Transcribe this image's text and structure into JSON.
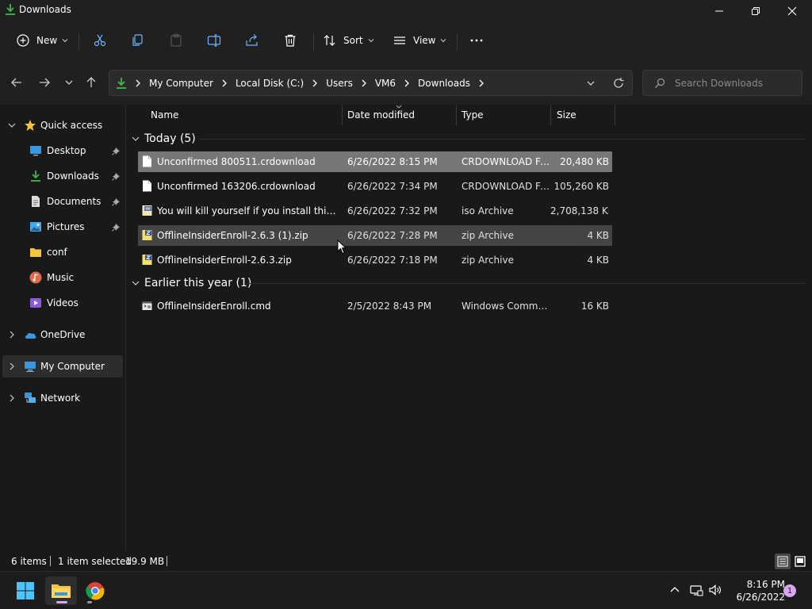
{
  "window": {
    "title": "Downloads"
  },
  "toolbar": {
    "new_label": "New",
    "sort_label": "Sort",
    "view_label": "View"
  },
  "address": {
    "crumbs": [
      "My Computer",
      "Local Disk (C:)",
      "Users",
      "VM6",
      "Downloads"
    ],
    "search_placeholder": "Search Downloads"
  },
  "sidebar": {
    "quick_access": "Quick access",
    "items": [
      {
        "label": "Desktop",
        "icon": "desktop-icon",
        "pinned": true
      },
      {
        "label": "Downloads",
        "icon": "download-icon",
        "pinned": true
      },
      {
        "label": "Documents",
        "icon": "document-icon",
        "pinned": true
      },
      {
        "label": "Pictures",
        "icon": "picture-icon",
        "pinned": true
      },
      {
        "label": "conf",
        "icon": "folder-icon",
        "pinned": false
      },
      {
        "label": "Music",
        "icon": "music-icon",
        "pinned": false
      },
      {
        "label": "Videos",
        "icon": "video-icon",
        "pinned": false
      }
    ],
    "onedrive": "OneDrive",
    "my_computer": "My Computer",
    "network": "Network"
  },
  "columns": {
    "name": "Name",
    "date": "Date modified",
    "type": "Type",
    "size": "Size"
  },
  "groups": [
    {
      "label": "Today (5)",
      "files": [
        {
          "name": "Unconfirmed 800511.crdownload",
          "date": "6/26/2022 8:15 PM",
          "type": "CRDOWNLOAD File",
          "size": "20,480 KB",
          "selected": true,
          "icon": "blank-file-icon"
        },
        {
          "name": "Unconfirmed 163206.crdownload",
          "date": "6/26/2022 7:34 PM",
          "type": "CRDOWNLOAD File",
          "size": "105,260 KB",
          "selected": false,
          "icon": "blank-file-icon"
        },
        {
          "name": "You will kill yourself if you install this so f...",
          "date": "6/26/2022 7:32 PM",
          "type": "iso Archive",
          "size": "2,708,138 KB",
          "selected": false,
          "icon": "iso-file-icon"
        },
        {
          "name": "OfflineInsiderEnroll-2.6.3 (1).zip",
          "date": "6/26/2022 7:28 PM",
          "type": "zip Archive",
          "size": "4 KB",
          "selected": false,
          "hovered": true,
          "icon": "zip-file-icon"
        },
        {
          "name": "OfflineInsiderEnroll-2.6.3.zip",
          "date": "6/26/2022 7:18 PM",
          "type": "zip Archive",
          "size": "4 KB",
          "selected": false,
          "icon": "zip-file-icon"
        }
      ]
    },
    {
      "label": "Earlier this year (1)",
      "files": [
        {
          "name": "OfflineInsiderEnroll.cmd",
          "date": "2/5/2022 8:43 PM",
          "type": "Windows Comma...",
          "size": "16 KB",
          "selected": false,
          "icon": "cmd-file-icon"
        }
      ]
    }
  ],
  "status": {
    "items": "6 items",
    "selection": "1 item selected",
    "selection_size": "19.9 MB"
  },
  "taskbar": {
    "time": "8:16 PM",
    "date": "6/26/2022",
    "notifications": "1"
  },
  "colors": {
    "background": "#191919",
    "chrome": "#202020",
    "selection": "#777777",
    "accent_green": "#3fb950",
    "folder_yellow": "#f4c542"
  }
}
